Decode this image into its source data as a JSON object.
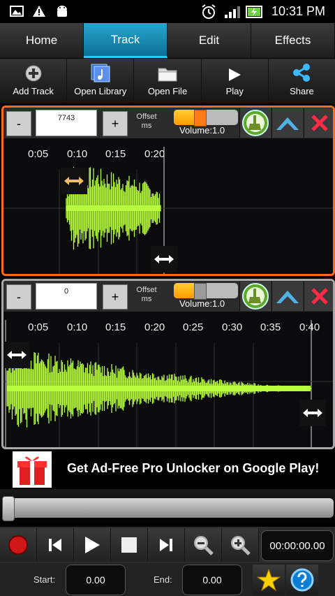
{
  "status": {
    "time": "10:31 PM"
  },
  "tabs": [
    {
      "label": "Home",
      "active": false
    },
    {
      "label": "Track",
      "active": true
    },
    {
      "label": "Edit",
      "active": false
    },
    {
      "label": "Effects",
      "active": false
    }
  ],
  "toolbar": [
    {
      "label": "Add Track",
      "icon": "add-icon"
    },
    {
      "label": "Open Library",
      "icon": "music-library-icon"
    },
    {
      "label": "Open File",
      "icon": "folder-icon"
    },
    {
      "label": "Play",
      "icon": "play-icon"
    },
    {
      "label": "Share",
      "icon": "share-icon"
    }
  ],
  "tracks": [
    {
      "offset_value": "7743",
      "minus": "-",
      "plus": "+",
      "offset_label_1": "Offset",
      "offset_label_2": "ms",
      "volume_label": "Volume:1.0",
      "volume_level": 0.4,
      "ticks": [
        "0:05",
        "0:10",
        "0:15",
        "0:20"
      ]
    },
    {
      "offset_value": "0",
      "minus": "-",
      "plus": "+",
      "offset_label_1": "Offset",
      "offset_label_2": "ms",
      "volume_label": "Volume:1.0",
      "volume_level": 0.4,
      "ticks": [
        "0:05",
        "0:10",
        "0:15",
        "0:20",
        "0:25",
        "0:30",
        "0:35",
        "0:40"
      ]
    }
  ],
  "ad": {
    "text": "Get Ad-Free Pro Unlocker on Google Play!"
  },
  "player": {
    "time": "00:00:00.00",
    "position": 0.0
  },
  "bottom": {
    "start_label": "Start:",
    "start_value": "0.00",
    "end_label": "End:",
    "end_value": "0.00"
  },
  "colors": {
    "accent": "#1f9fcf",
    "waveform": "#b7ff3c",
    "active_border": "#ff6a1a",
    "inactive_border": "#a8a8a8",
    "close": "#ff2a4a"
  }
}
